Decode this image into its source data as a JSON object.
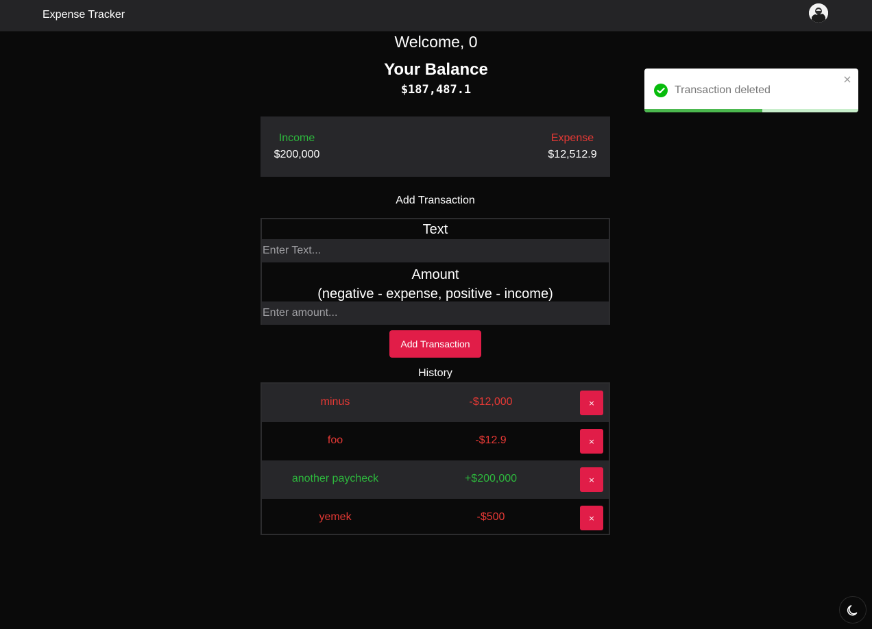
{
  "navbar": {
    "brand": "Expense Tracker",
    "avatar_icon": "user-avatar-icon"
  },
  "welcome": "Welcome, 0",
  "balance": {
    "title": "Your Balance",
    "amount": "$187,487.1"
  },
  "summary": {
    "income_label": "Income",
    "income_value": "$200,000",
    "expense_label": "Expense",
    "expense_value": "$12,512.9"
  },
  "form": {
    "title": "Add Transaction",
    "text_label": "Text",
    "text_placeholder": "Enter Text...",
    "amount_label": "Amount",
    "amount_hint": "(negative - expense, positive - income)",
    "amount_placeholder": "Enter amount...",
    "submit_label": "Add Transaction"
  },
  "history": {
    "title": "History",
    "delete_label": "×",
    "items": [
      {
        "text": "minus",
        "amount": "-$12,000",
        "type": "expense"
      },
      {
        "text": "foo",
        "amount": "-$12.9",
        "type": "expense"
      },
      {
        "text": "another paycheck",
        "amount": "+$200,000",
        "type": "income"
      },
      {
        "text": "yemek",
        "amount": "-$500",
        "type": "expense"
      }
    ]
  },
  "toast": {
    "message": "Transaction deleted",
    "icon": "check-circle-icon",
    "close_label": "×",
    "progress": 0.55
  },
  "theme_toggle_icon": "moon-icon",
  "colors": {
    "income": "#2db83d",
    "expense": "#e53935",
    "accent": "#e11d48"
  }
}
